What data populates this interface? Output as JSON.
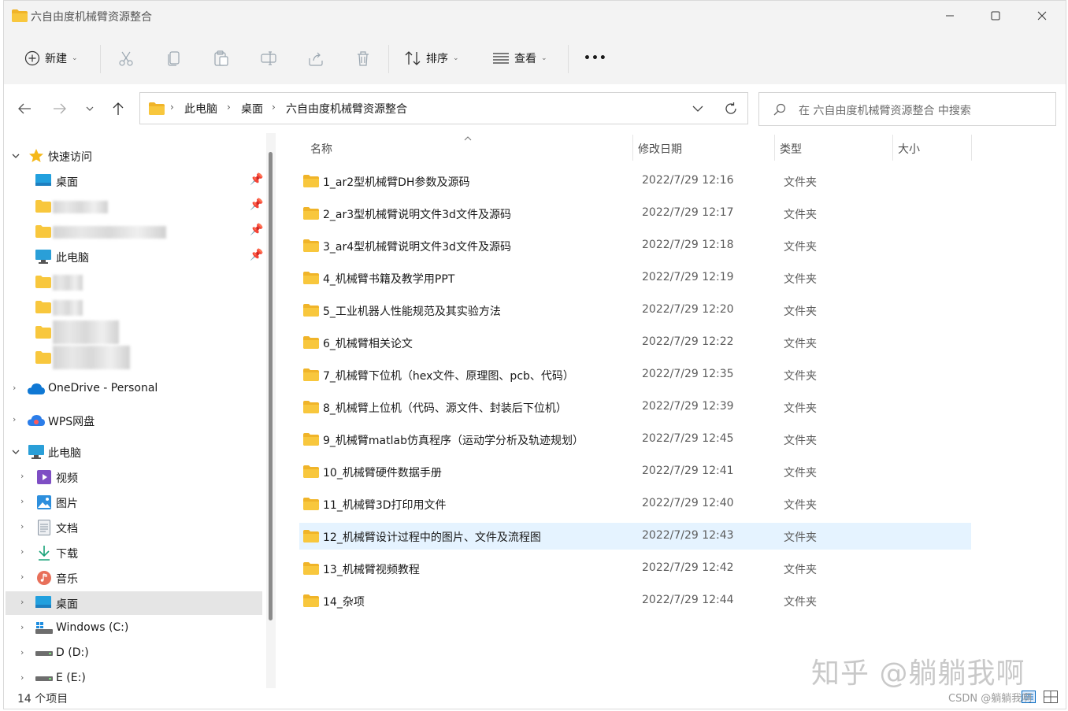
{
  "window": {
    "title": "六自由度机械臂资源整合"
  },
  "toolbar": {
    "new_label": "新建",
    "sort_label": "排序",
    "view_label": "查看",
    "more_label": "•••"
  },
  "address": {
    "segments": [
      "此电脑",
      "桌面",
      "六自由度机械臂资源整合"
    ]
  },
  "search": {
    "placeholder": "在 六自由度机械臂资源整合 中搜索"
  },
  "sidebar": {
    "quick_access": "快速访问",
    "desktop": "桌面",
    "this_pc_pinned": "此电脑",
    "onedrive": "OneDrive - Personal",
    "wps": "WPS网盘",
    "this_pc": "此电脑",
    "videos": "视频",
    "pictures": "图片",
    "documents": "文档",
    "downloads": "下载",
    "music": "音乐",
    "desktop2": "桌面",
    "drive_c": "Windows (C:)",
    "drive_d": "D (D:)",
    "drive_e": "E (E:)"
  },
  "columns": {
    "name": "名称",
    "date": "修改日期",
    "type": "类型",
    "size": "大小"
  },
  "files": [
    {
      "name": "1_ar2型机械臂DH参数及源码",
      "date": "2022/7/29 12:16",
      "type": "文件夹"
    },
    {
      "name": "2_ar3型机械臂说明文件3d文件及源码",
      "date": "2022/7/29 12:17",
      "type": "文件夹"
    },
    {
      "name": "3_ar4型机械臂说明文件3d文件及源码",
      "date": "2022/7/29 12:18",
      "type": "文件夹"
    },
    {
      "name": "4_机械臂书籍及教学用PPT",
      "date": "2022/7/29 12:19",
      "type": "文件夹"
    },
    {
      "name": "5_工业机器人性能规范及其实验方法",
      "date": "2022/7/29 12:20",
      "type": "文件夹"
    },
    {
      "name": "6_机械臂相关论文",
      "date": "2022/7/29 12:22",
      "type": "文件夹"
    },
    {
      "name": "7_机械臂下位机（hex文件、原理图、pcb、代码）",
      "date": "2022/7/29 12:35",
      "type": "文件夹"
    },
    {
      "name": "8_机械臂上位机（代码、源文件、封装后下位机）",
      "date": "2022/7/29 12:39",
      "type": "文件夹"
    },
    {
      "name": "9_机械臂matlab仿真程序（运动学分析及轨迹规划）",
      "date": "2022/7/29 12:45",
      "type": "文件夹"
    },
    {
      "name": "10_机械臂硬件数据手册",
      "date": "2022/7/29 12:41",
      "type": "文件夹"
    },
    {
      "name": "11_机械臂3D打印用文件",
      "date": "2022/7/29 12:40",
      "type": "文件夹"
    },
    {
      "name": "12_机械臂设计过程中的图片、文件及流程图",
      "date": "2022/7/29 12:43",
      "type": "文件夹"
    },
    {
      "name": "13_机械臂视频教程",
      "date": "2022/7/29 12:42",
      "type": "文件夹"
    },
    {
      "name": "14_杂项",
      "date": "2022/7/29 12:44",
      "type": "文件夹"
    }
  ],
  "status": {
    "count": "14 个项目"
  },
  "watermark": {
    "zhihu": "知乎 @躺躺我啊",
    "csdn": "CSDN @躺躺我啊"
  },
  "colors": {
    "folder": "#f8c73d",
    "selection": "#e5f3ff",
    "accent": "#0067c0"
  }
}
